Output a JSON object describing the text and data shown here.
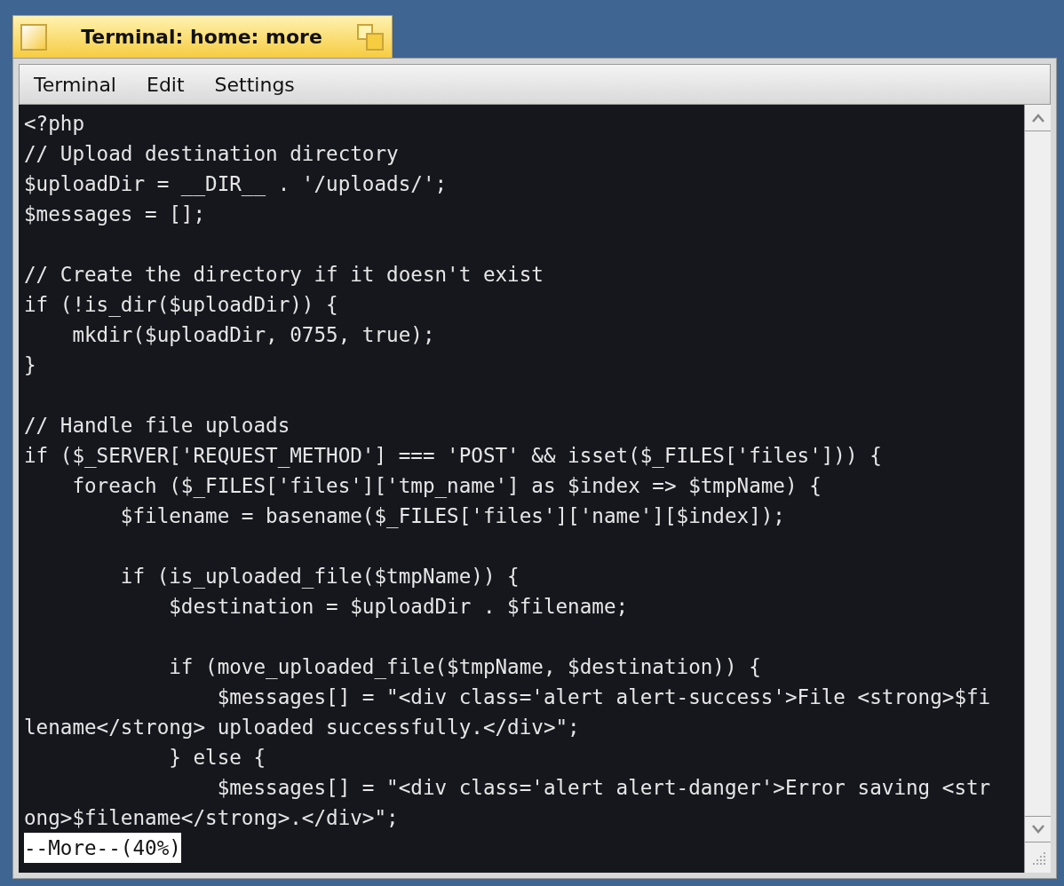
{
  "window": {
    "title": "Terminal: home: more"
  },
  "menu": [
    {
      "label": "Terminal"
    },
    {
      "label": "Edit"
    },
    {
      "label": "Settings"
    }
  ],
  "terminal": {
    "blocks": [
      [
        "<?php",
        "// Upload destination directory",
        "$uploadDir = __DIR__ . '/uploads/';",
        "$messages = [];"
      ],
      [
        "// Create the directory if it doesn't exist",
        "if (!is_dir($uploadDir)) {",
        "    mkdir($uploadDir, 0755, true);",
        "}"
      ],
      [
        "// Handle file uploads",
        "if ($_SERVER['REQUEST_METHOD'] === 'POST' && isset($_FILES['files'])) {",
        "    foreach ($_FILES['files']['tmp_name'] as $index => $tmpName) {",
        "        $filename = basename($_FILES['files']['name'][$index]);"
      ],
      [
        "        if (is_uploaded_file($tmpName)) {",
        "            $destination = $uploadDir . $filename;"
      ],
      [
        "            if (move_uploaded_file($tmpName, $destination)) {",
        "                $messages[] = \"<div class='alert alert-success'>File <strong>$fi",
        "lename</strong> uploaded successfully.</div>\";",
        "            } else {",
        "                $messages[] = \"<div class='alert alert-danger'>Error saving <str",
        "ong>$filename</strong>.</div>\";"
      ]
    ],
    "prompt": "--More--(40%)"
  }
}
